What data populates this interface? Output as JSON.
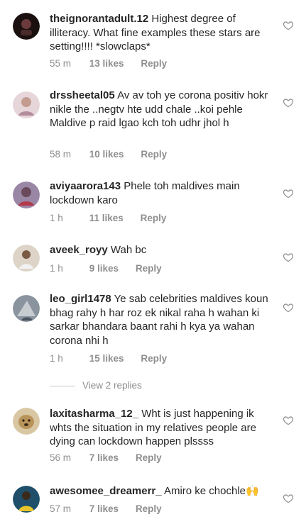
{
  "comments": [
    {
      "username": "theignorantadult.12",
      "text": "Highest degree of illiteracy. What fine examples these stars are setting!!!! *slowclaps*",
      "time": "55 m",
      "likes": "13 likes",
      "reply": "Reply",
      "avatar_color": "#3a2a2a"
    },
    {
      "username": "drssheetal05",
      "text": "Av av toh ye corona positiv hokr nikle the ..negtv hte udd chale ..koi pehle Maldive p raid lgao kch toh udhr jhol h",
      "time": "58 m",
      "likes": "10 likes",
      "reply": "Reply",
      "avatar_color": "#d8c3c9"
    },
    {
      "username": "aviyaarora143",
      "text": "Phele toh maldives main lockdown karo",
      "time": "1 h",
      "likes": "11 likes",
      "reply": "Reply",
      "avatar_color": "#8a6a8a"
    },
    {
      "username": "aveek_royy",
      "text": "Wah bc",
      "time": "1 h",
      "likes": "9 likes",
      "reply": "Reply",
      "avatar_color": "#c9b9a8"
    },
    {
      "username": "leo_girl1478",
      "text": "Ye sab celebrities maldives koun bhag rahy h har roz ek nikal raha h wahan ki sarkar bhandara baant rahi h kya ya wahan corona nhi h",
      "time": "1 h",
      "likes": "15 likes",
      "reply": "Reply",
      "avatar_color": "#6b7580"
    },
    {
      "username": "laxitasharma_12_",
      "text": "Wht is just happening ik whts the situation in my relatives people are dying can lockdown happen plssss",
      "time": "56 m",
      "likes": "7 likes",
      "reply": "Reply",
      "avatar_color": "#b89a6a"
    },
    {
      "username": "awesomee_dreamerr_",
      "text": "Amiro ke chochle🙌",
      "time": "57 m",
      "likes": "7 likes",
      "reply": "Reply",
      "avatar_color": "#1f4f6a"
    }
  ],
  "view_replies": "View 2 replies"
}
